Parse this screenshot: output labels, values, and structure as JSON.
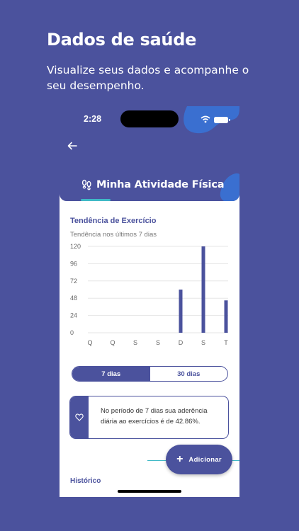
{
  "promo": {
    "title": "Dados de saúde",
    "subtitle": "Visualize seus dados e acompanhe o seu desempenho."
  },
  "status_bar": {
    "time": "2:28"
  },
  "header": {
    "title": "Minha Atividade Física"
  },
  "section": {
    "title": "Tendência de Exercício",
    "subtitle": "Tendência nos últimos 7 dias"
  },
  "chart_data": {
    "type": "bar",
    "categories": [
      "Q",
      "Q",
      "S",
      "S",
      "D",
      "S",
      "T"
    ],
    "values": [
      0,
      0,
      0,
      0,
      60,
      120,
      45
    ],
    "yticks": [
      "120",
      "96",
      "72",
      "48",
      "24",
      "0"
    ],
    "ylim": [
      0,
      120
    ],
    "grid": true,
    "title": "",
    "xlabel": "",
    "ylabel": ""
  },
  "toggle": {
    "options": [
      "7 dias",
      "30 dias"
    ],
    "selected": "7 dias"
  },
  "info": {
    "text": "No período de 7 dias sua aderência diária ao exercícios é de 42.86%."
  },
  "fab": {
    "label": "Adicionar"
  },
  "history": {
    "title": "Histórico"
  },
  "colors": {
    "primary": "#4b529d",
    "accent": "#3fb9c6",
    "bar": "#4b529d"
  },
  "icons": [
    "back-arrow-icon",
    "footprints-icon",
    "heart-icon",
    "plus-icon",
    "wifi-icon",
    "battery-icon"
  ]
}
